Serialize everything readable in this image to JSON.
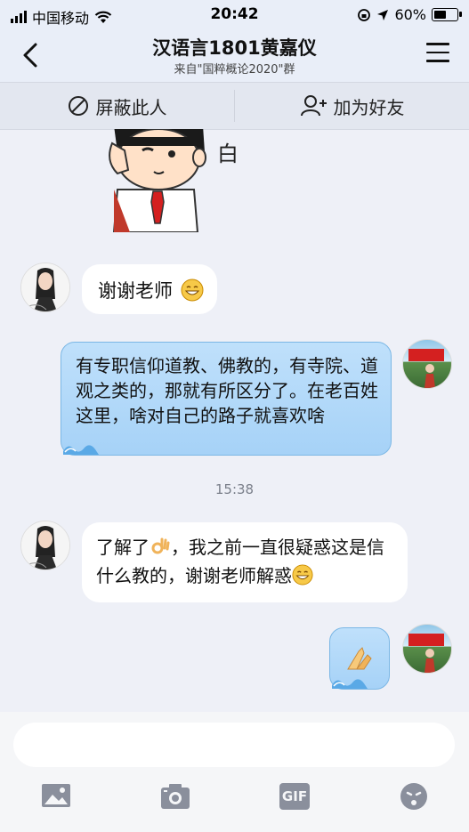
{
  "status_bar": {
    "carrier": "中国移动",
    "time": "20:42",
    "battery_percent": "60%",
    "battery_level": 0.6
  },
  "header": {
    "title": "汉语言1801黄嘉仪",
    "subtitle": "来自\"国粹概论2020\"群"
  },
  "actions": {
    "block_label": "屏蔽此人",
    "add_friend_label": "加为好友"
  },
  "messages": {
    "sticker_top_char": "白",
    "msg1": "谢谢老师",
    "msg2": "有专职信仰道教、佛教的，有寺院、道观之类的，那就有所区分了。在老百姓这里，啥对自己的路子就喜欢啥",
    "timestamp": "15:38",
    "msg3a": "了解了",
    "msg3b": "，我之前一直很疑惑这是信什么教的，谢谢老师解惑"
  },
  "toolbar": {
    "gif_label": "GIF"
  },
  "colors": {
    "background": "#eef0f7",
    "bubble_right": "#a6d2f7",
    "bubble_left": "#ffffff"
  }
}
